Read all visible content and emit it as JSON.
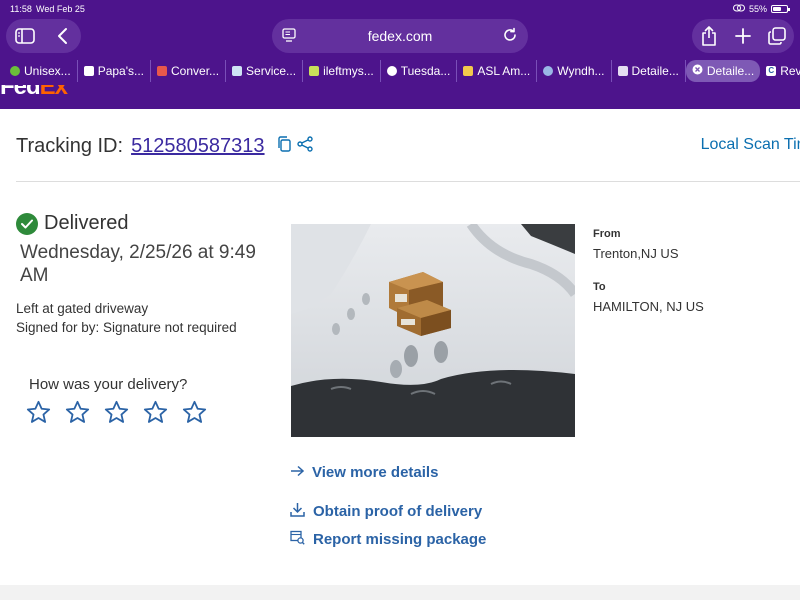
{
  "status_bar": {
    "time": "11:58",
    "date": "Wed Feb 25",
    "battery": "55%"
  },
  "browser": {
    "url": "fedex.com",
    "tabs": [
      {
        "label": "Unisex..."
      },
      {
        "label": "Papa's..."
      },
      {
        "label": "Conver..."
      },
      {
        "label": "Service..."
      },
      {
        "label": "ileftmys..."
      },
      {
        "label": "Tuesda..."
      },
      {
        "label": "ASL Am..."
      },
      {
        "label": "Wyndh..."
      },
      {
        "label": "Detaile..."
      },
      {
        "label": "Detaile...",
        "active": true
      },
      {
        "label": "Review..."
      }
    ]
  },
  "page": {
    "logo": {
      "fed": "Fed",
      "ex": "Ex"
    },
    "tracking_label": "Tracking ID:",
    "tracking_id": "512580587313",
    "local_scan": "Local Scan Tim",
    "status": "Delivered",
    "delivery_date": "Wednesday, 2/25/26 at 9:49 AM",
    "left_at": "Left at gated driveway",
    "signed_for": "Signed for by: Signature not required",
    "rating_question": "How was your delivery?",
    "rating": {
      "filled": 0,
      "max": 5
    },
    "links": {
      "view_details": "View more details",
      "proof": "Obtain proof of delivery",
      "report": "Report missing package"
    },
    "from_label": "From",
    "from_value": "Trenton,NJ US",
    "to_label": "To",
    "to_value": "HAMILTON, NJ US"
  },
  "colors": {
    "brand_purple": "#4d148c",
    "brand_orange": "#ff6200",
    "link_blue": "#2b63a6",
    "success_green": "#2e8a3a"
  }
}
